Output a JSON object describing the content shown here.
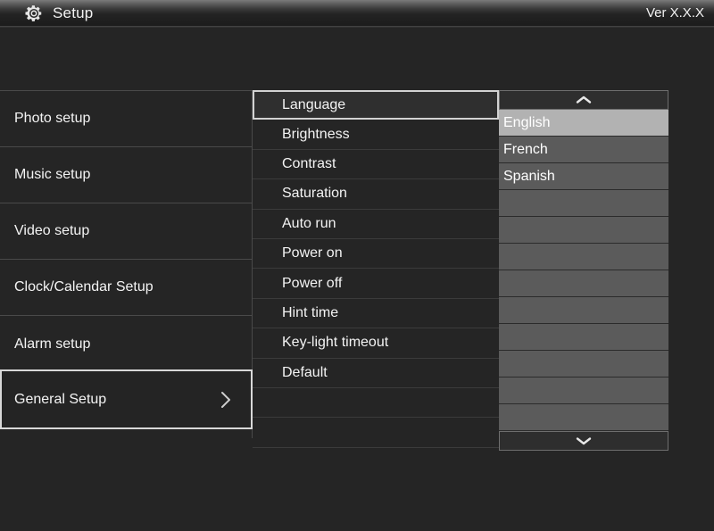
{
  "header": {
    "icon": "gear-icon",
    "title": "Setup",
    "version": "Ver X.X.X"
  },
  "colors": {
    "background": "#252525",
    "panel_border": "#4a4a4a",
    "row_separator": "#3b3b3b",
    "selection_outline": "#d8d8d8",
    "option_row_bg": "#5b5b5b",
    "option_row_selected_bg": "#b2b2b2",
    "text": "#f4f4f4"
  },
  "sidebar": {
    "items": [
      {
        "label": "Photo setup",
        "selected": false
      },
      {
        "label": "Music setup",
        "selected": false
      },
      {
        "label": "Video setup",
        "selected": false
      },
      {
        "label": "Clock/Calendar Setup",
        "selected": false
      },
      {
        "label": "Alarm setup",
        "selected": false
      }
    ],
    "selected_item": {
      "label": "General Setup",
      "selected": true,
      "chevron": "chevron-right-icon"
    }
  },
  "settings_list": {
    "items": [
      {
        "label": "Language",
        "selected": true
      },
      {
        "label": "Brightness",
        "selected": false
      },
      {
        "label": "Contrast",
        "selected": false
      },
      {
        "label": "Saturation",
        "selected": false
      },
      {
        "label": "Auto run",
        "selected": false
      },
      {
        "label": "Power on",
        "selected": false
      },
      {
        "label": "Power off",
        "selected": false
      },
      {
        "label": "Hint time",
        "selected": false
      },
      {
        "label": "Key-light timeout",
        "selected": false
      },
      {
        "label": "Default",
        "selected": false
      },
      {
        "label": "",
        "selected": false
      },
      {
        "label": "",
        "selected": false
      }
    ]
  },
  "option_list": {
    "scroll_up": "chevron-up-icon",
    "scroll_down": "chevron-down-icon",
    "options": [
      {
        "label": "English",
        "selected": true
      },
      {
        "label": "French",
        "selected": false
      },
      {
        "label": "Spanish",
        "selected": false
      },
      {
        "label": "",
        "selected": false
      },
      {
        "label": "",
        "selected": false
      },
      {
        "label": "",
        "selected": false
      },
      {
        "label": "",
        "selected": false
      },
      {
        "label": "",
        "selected": false
      },
      {
        "label": "",
        "selected": false
      },
      {
        "label": "",
        "selected": false
      },
      {
        "label": "",
        "selected": false
      },
      {
        "label": "",
        "selected": false
      }
    ]
  }
}
